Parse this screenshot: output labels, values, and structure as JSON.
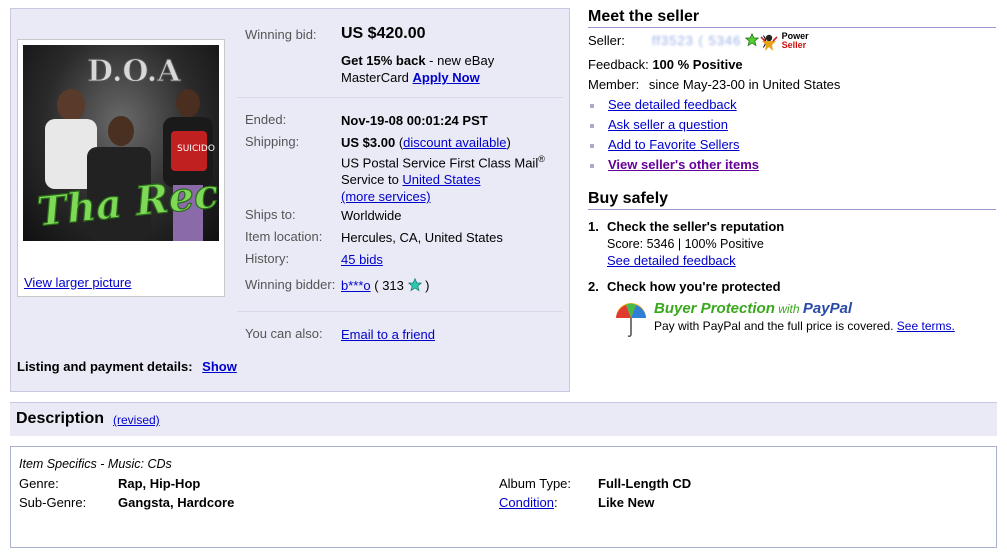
{
  "item": {
    "view_larger": "View larger picture",
    "cover": {
      "band": "D.O.A",
      "title": "Tha Recipe",
      "shirt": "SUICIDO"
    },
    "winning_bid_label": "Winning bid:",
    "winning_bid_value": "US $420.00",
    "cashback_bold": "Get 15% back",
    "cashback_rest": " - new eBay",
    "mastercard": "MasterCard ",
    "apply_now": "Apply Now",
    "ended_label": "Ended:",
    "ended_value": "Nov-19-08 00:01:24 PST",
    "shipping_label": "Shipping:",
    "shipping_price": "US $3.00",
    "shipping_paren_open": " (",
    "discount_link": "discount available",
    "shipping_paren_close": ")",
    "shipping_service": "US Postal Service First Class Mail",
    "shipping_reg": "®",
    "service_to": "Service to ",
    "united_states": "United States",
    "more_services": "(more services)",
    "ships_to_label": "Ships to:",
    "ships_to_value": "Worldwide",
    "location_label": "Item location:",
    "location_value": "Hercules, CA, United States",
    "history_label": "History:",
    "history_value": "45 bids",
    "bidder_label": "Winning bidder:",
    "bidder_name": "b***o",
    "bidder_score_open": " ( 313 ",
    "bidder_score_close": " )",
    "also_label": "You can also:",
    "email_friend": "Email to a friend",
    "listing_label": "Listing and payment details:",
    "listing_show": "Show"
  },
  "seller": {
    "title": "Meet the seller",
    "seller_label": "Seller:",
    "seller_name": "ff3523 ( 5346",
    "seller_close": " )",
    "power_1": "Power",
    "power_2": "Seller",
    "feedback_label": "Feedback:",
    "feedback_value": "100 % Positive",
    "member_label": "Member:",
    "member_value": "since May-23-00 in United States",
    "links": [
      "See detailed feedback",
      "Ask seller a question",
      "Add to Favorite Sellers",
      "View seller's other items"
    ]
  },
  "buy_safely": {
    "title": "Buy safely",
    "step1_num": "1.",
    "step1_title": "Check the seller's reputation",
    "step1_score": "Score: 5346 | 100% Positive",
    "step1_link": "See detailed feedback",
    "step2_num": "2.",
    "step2_title": "Check how you're protected",
    "bp_label": "Buyer Protection",
    "bp_with": " with ",
    "bp_paypal": "PayPal",
    "bp_text": "Pay with PayPal and the full price is covered. ",
    "bp_terms": "See terms."
  },
  "description": {
    "title": "Description",
    "revised": "(revised)",
    "specifics_title": "Item Specifics - Music: CDs",
    "genre_label": "Genre:",
    "genre_value": "Rap, Hip-Hop",
    "subgenre_label": "Sub-Genre:",
    "subgenre_value": "Gangsta, Hardcore",
    "album_label": "Album Type:",
    "album_value": "Full-Length CD",
    "condition_label": "Condition",
    "condition_colon": ":",
    "condition_value": "Like New"
  },
  "colors": {
    "panel": "#eaeaf7",
    "link": "#0000cc",
    "visited": "#660099",
    "star": "#2bb673"
  }
}
